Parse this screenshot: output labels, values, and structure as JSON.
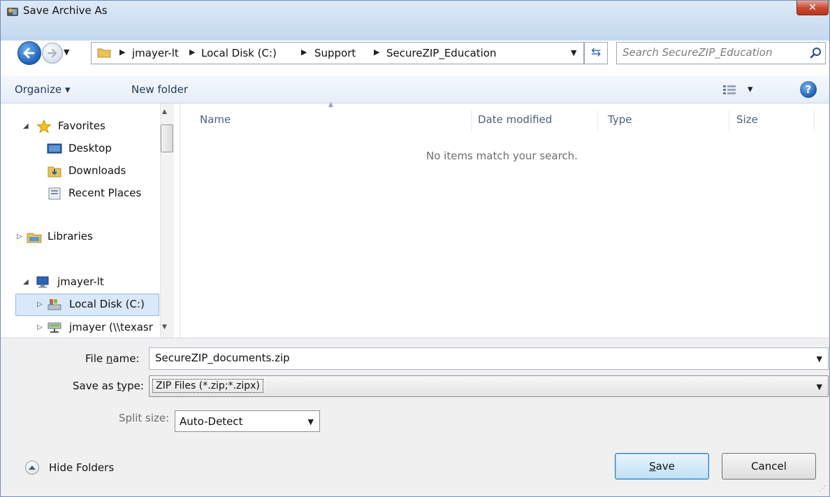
{
  "window": {
    "title": "Save Archive As",
    "close_label": "✕"
  },
  "navigation": {
    "breadcrumbs": [
      "jmayer-lt",
      "Local Disk (C:)",
      "Support",
      "SecureZIP_Education"
    ],
    "search_placeholder": "Search SecureZIP_Education"
  },
  "toolbar": {
    "organize_label": "Organize ▾",
    "new_folder_label": "New folder",
    "views_arrow": "▾",
    "help_label": "?"
  },
  "nav_pane": {
    "favorites": "Favorites",
    "desktop": "Desktop",
    "downloads": "Downloads",
    "recent_places": "Recent Places",
    "libraries": "Libraries",
    "computer": "jmayer-lt",
    "local_disk": "Local Disk (C:)",
    "network_drive": "jmayer (\\\\texasr"
  },
  "file_list": {
    "columns": [
      "Name",
      "Date modified",
      "Type",
      "Size"
    ],
    "empty_message": "No items match your search."
  },
  "form": {
    "file_name_label_pre": "File ",
    "file_name_label_key": "n",
    "file_name_label_post": "ame:",
    "file_name_value": "SecureZIP_documents.zip",
    "save_type_label_pre": "Save as ",
    "save_type_label_key": "t",
    "save_type_label_post": "ype:",
    "save_type_value": "ZIP Files (*.zip;*.zipx)",
    "split_size_label": "Split size:",
    "split_size_value": "Auto-Detect"
  },
  "footer": {
    "hide_folders_label": "Hide Folders",
    "save_key": "S",
    "save_rest": "ave",
    "cancel_label": "Cancel"
  },
  "colors": {
    "accent": "#1f5fb5",
    "selection": "#d9e9fb",
    "close": "#c8452f"
  }
}
